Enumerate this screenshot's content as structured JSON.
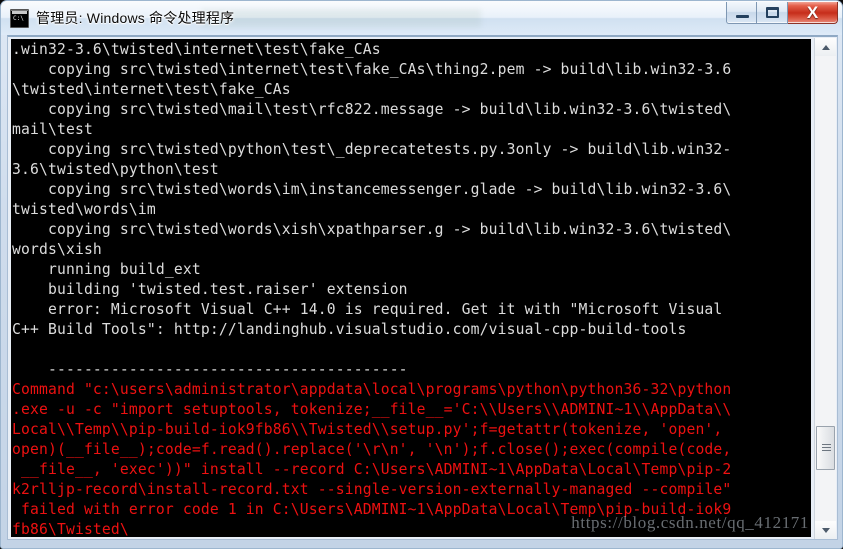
{
  "window": {
    "title": "管理员: Windows 命令处理程序",
    "icon": "cmd-console-icon",
    "buttons": {
      "minimize": "–",
      "maximize": "□",
      "close": "X"
    }
  },
  "console": {
    "foreground_color": "#dcdcdc",
    "error_color": "#ee1111",
    "background_color": "#000000",
    "lines": [
      {
        "text": ".win32-3.6\\twisted\\internet\\test\\fake_CAs",
        "type": "out"
      },
      {
        "text": "    copying src\\twisted\\internet\\test\\fake_CAs\\thing2.pem -> build\\lib.win32-3.6",
        "type": "out"
      },
      {
        "text": "\\twisted\\internet\\test\\fake_CAs",
        "type": "out"
      },
      {
        "text": "    copying src\\twisted\\mail\\test\\rfc822.message -> build\\lib.win32-3.6\\twisted\\",
        "type": "out"
      },
      {
        "text": "mail\\test",
        "type": "out"
      },
      {
        "text": "    copying src\\twisted\\python\\test\\_deprecatetests.py.3only -> build\\lib.win32-",
        "type": "out"
      },
      {
        "text": "3.6\\twisted\\python\\test",
        "type": "out"
      },
      {
        "text": "    copying src\\twisted\\words\\im\\instancemessenger.glade -> build\\lib.win32-3.6\\",
        "type": "out"
      },
      {
        "text": "twisted\\words\\im",
        "type": "out"
      },
      {
        "text": "    copying src\\twisted\\words\\xish\\xpathparser.g -> build\\lib.win32-3.6\\twisted\\",
        "type": "out"
      },
      {
        "text": "words\\xish",
        "type": "out"
      },
      {
        "text": "    running build_ext",
        "type": "out"
      },
      {
        "text": "    building 'twisted.test.raiser' extension",
        "type": "out"
      },
      {
        "text": "    error: Microsoft Visual C++ 14.0 is required. Get it with \"Microsoft Visual",
        "type": "out"
      },
      {
        "text": "C++ Build Tools\": http://landinghub.visualstudio.com/visual-cpp-build-tools",
        "type": "out"
      },
      {
        "text": "",
        "type": "out"
      },
      {
        "text": "    ----------------------------------------",
        "type": "out"
      },
      {
        "text": "Command \"c:\\users\\administrator\\appdata\\local\\programs\\python\\python36-32\\python",
        "type": "err"
      },
      {
        "text": ".exe -u -c \"import setuptools, tokenize;__file__='C:\\\\Users\\\\ADMINI~1\\\\AppData\\\\",
        "type": "err"
      },
      {
        "text": "Local\\\\Temp\\\\pip-build-iok9fb86\\\\Twisted\\\\setup.py';f=getattr(tokenize, 'open',",
        "type": "err"
      },
      {
        "text": "open)(__file__);code=f.read().replace('\\r\\n', '\\n');f.close();exec(compile(code,",
        "type": "err"
      },
      {
        "text": " __file__, 'exec'))\" install --record C:\\Users\\ADMINI~1\\AppData\\Local\\Temp\\pip-2",
        "type": "err"
      },
      {
        "text": "k2rlljp-record\\install-record.txt --single-version-externally-managed --compile\"",
        "type": "err"
      },
      {
        "text": " failed with error code 1 in C:\\Users\\ADMINI~1\\AppData\\Local\\Temp\\pip-build-iok9",
        "type": "err"
      },
      {
        "text": "fb86\\Twisted\\",
        "type": "err"
      }
    ]
  },
  "scrollbar": {
    "up_arrow": "▲",
    "down_arrow": "▼",
    "thumb_position_percent": 88
  },
  "watermark": {
    "text": "https://blog.csdn.net/qq_412171"
  }
}
